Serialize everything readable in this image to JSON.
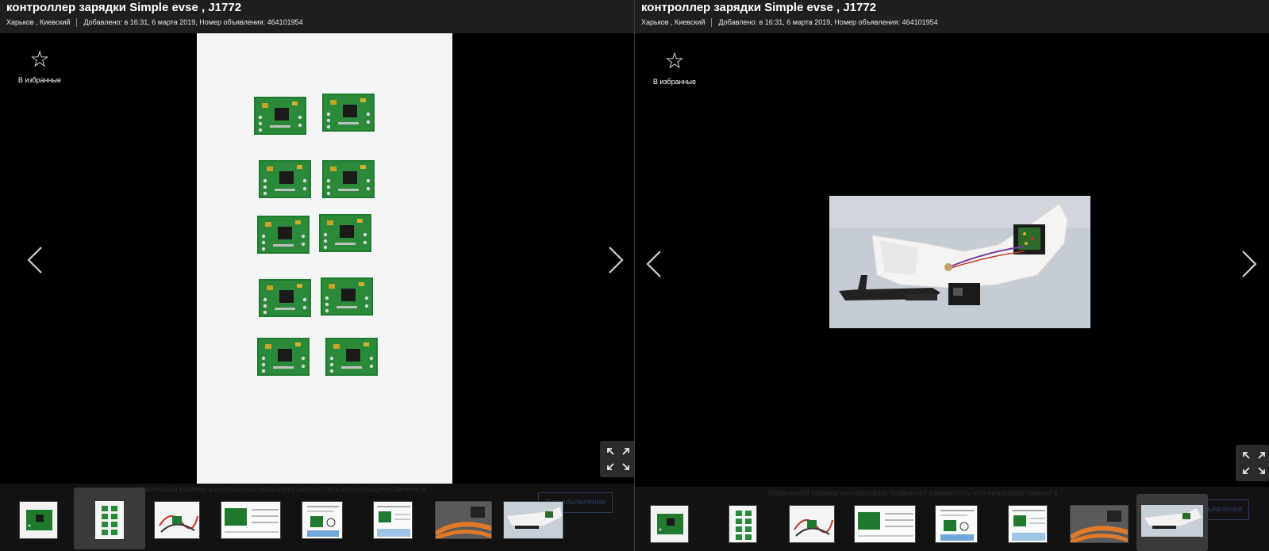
{
  "left": {
    "title": "контроллер зарядки Simple evse , J1772",
    "location": "Харьков , Киевский",
    "added": "Добавлено: в 16:31, 6 марта 2019, Номер объявления: 464101954",
    "favorite_label": "В избранные",
    "thumb_count": 8,
    "active_thumb": 2,
    "behind_text": "Маленький размер контроллера позволяет разместить его непосредственно в",
    "behind_button": "Все объявления"
  },
  "right": {
    "title": "контроллер зарядки Simple evse , J1772",
    "location": "Харьков , Киевский",
    "added": "Добавлено: в 16:31, 6 марта 2019, Номер объявления: 464101954",
    "favorite_label": "В избранные",
    "thumb_count": 8,
    "active_thumb": 8,
    "behind_text": "Маленький размер контроллера позволяет разместить его непосредственно в",
    "behind_button": "все объявления"
  },
  "colors": {
    "header_bg": "#1f1f1f",
    "viewer_bg": "#000000",
    "pcb_green": "#1f7a2e",
    "plug_orange": "#e07a28"
  },
  "icons": [
    "star-icon",
    "chevron-left-icon",
    "chevron-right-icon",
    "fullscreen-icon"
  ]
}
